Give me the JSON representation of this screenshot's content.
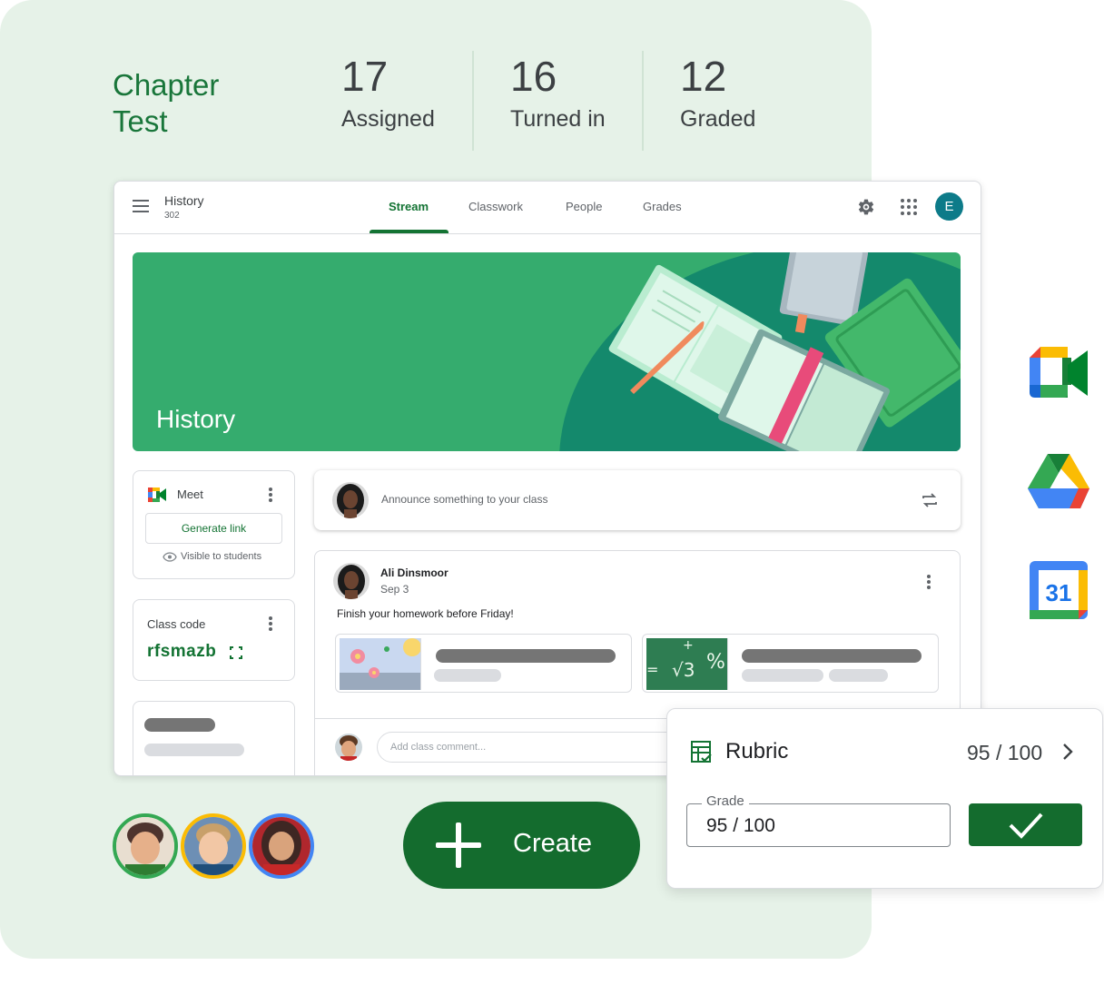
{
  "stats": {
    "chapter_title": [
      "Chapter",
      "Test"
    ],
    "assigned": {
      "number": "17",
      "label": "Assigned"
    },
    "turned_in": {
      "number": "16",
      "label": "Turned in"
    },
    "graded": {
      "number": "12",
      "label": "Graded"
    }
  },
  "classroom": {
    "class_name": "History",
    "section": "302",
    "tabs": [
      {
        "label": "Stream",
        "active": true
      },
      {
        "label": "Classwork",
        "active": false
      },
      {
        "label": "People",
        "active": false
      },
      {
        "label": "Grades",
        "active": false
      }
    ],
    "avatar_letter": "E",
    "banner_title": "History",
    "meet": {
      "label": "Meet",
      "button": "Generate link",
      "visibility": "Visible to students"
    },
    "class_code": {
      "label": "Class code",
      "value": "rfsmazb"
    },
    "announce_placeholder": "Announce something to your class",
    "post": {
      "author": "Ali Dinsmoor",
      "date": "Sep 3",
      "body": "Finish your homework before Friday!"
    },
    "comment_placeholder": "Add class comment..."
  },
  "create_button": {
    "label": "Create"
  },
  "rubric": {
    "title": "Rubric",
    "score": "95 / 100",
    "grade_label": "Grade",
    "grade_value": "95 / 100"
  },
  "icons": [
    "google-meet-icon",
    "google-drive-icon",
    "google-calendar-icon"
  ],
  "calendar_day": "31",
  "colors": {
    "brand_green": "#137333",
    "panel_bg": "#e6f2e8",
    "banner_green": "#35ac6e",
    "create_green": "#146c2e",
    "avatar_teal": "#0d7b89"
  }
}
